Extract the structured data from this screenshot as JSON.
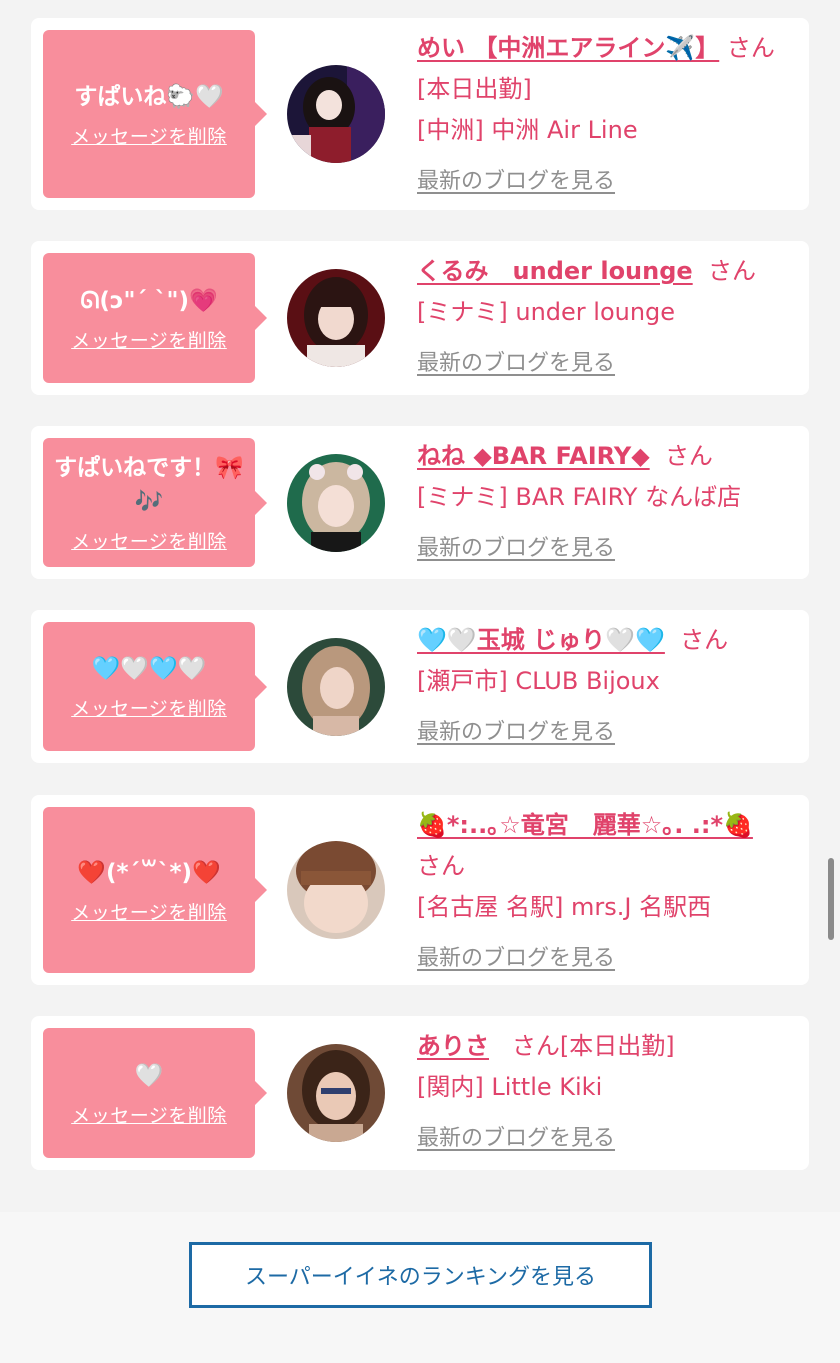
{
  "entries": [
    {
      "message": "すぱいね🐑🤍",
      "delete_label": "メッセージを削除",
      "name": "めい 【中洲エアライン✈️】",
      "san": "さん[本日出勤]",
      "shop": "[中洲] 中洲 Air Line",
      "blog_label": "最新のブログを見る"
    },
    {
      "message": "ᘏ(ɔ\"ˊ ˋ\")💗",
      "delete_label": "メッセージを削除",
      "name": "くるみ　under lounge",
      "san": "さん",
      "shop": "[ミナミ] under lounge",
      "blog_label": "最新のブログを見る"
    },
    {
      "message": "すぱいねです！🎀🎶",
      "delete_label": "メッセージを削除",
      "name": "ねね ◆BAR FAIRY◆",
      "san": "さん",
      "shop": "[ミナミ] BAR FAIRY なんば店",
      "blog_label": "最新のブログを見る"
    },
    {
      "message": "🩵🤍🩵🤍",
      "delete_label": "メッセージを削除",
      "name": "🩵🤍玉城 じゅり🤍🩵",
      "san": "さん",
      "shop": "[瀬戸市] CLUB Bijoux",
      "blog_label": "最新のブログを見る"
    },
    {
      "message": "❤️(*´꒳`*)❤️",
      "delete_label": "メッセージを削除",
      "name": "🍓*:..｡☆竜宮　麗華☆｡. .:*🍓",
      "san": "さん",
      "shop": "[名古屋 名駅] mrs.J 名駅西",
      "blog_label": "最新のブログを見る"
    },
    {
      "message": "🤍",
      "delete_label": "メッセージを削除",
      "name": "ありさ",
      "san": "さん[本日出勤]",
      "shop": "[関内] Little Kiki",
      "blog_label": "最新のブログを見る"
    }
  ],
  "footer": {
    "ranking_button_label": "スーパーイイネのランキングを見る"
  },
  "colors": {
    "bubble": "#f88e9c",
    "name_text": "#e0436b",
    "blog_link": "#8f8f8f",
    "ranking_border": "#1d6aa5"
  },
  "icons": [
    "speech-bubble-pointer",
    "avatar-photo",
    "vertical-scrollbar"
  ]
}
